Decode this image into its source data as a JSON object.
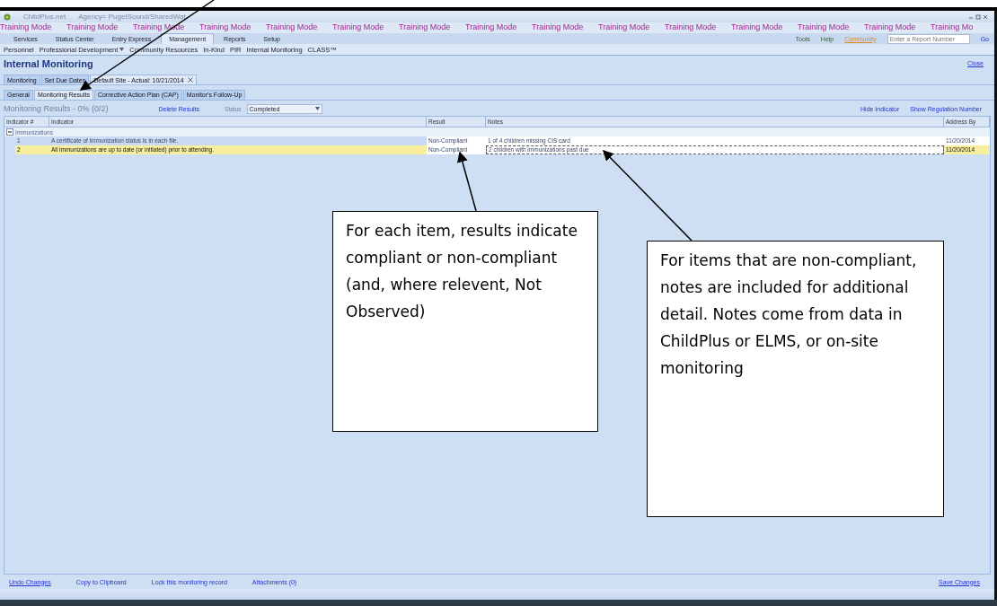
{
  "window": {
    "title": "ChildPlus.net",
    "agency": "Agency= PugetSound/SharedWat"
  },
  "training_banner": [
    "Training Mode",
    "Training Mode",
    "Training Mode",
    "Training Mode",
    "Training Mode",
    "Training Mode",
    "Training Mode",
    "Training Mode",
    "Training Mode",
    "Training Mode",
    "Training Mode",
    "Training Mode",
    "Training Mode",
    "Training Mode",
    "Training Mo"
  ],
  "main_tabs": [
    {
      "label": "Services",
      "selected": false
    },
    {
      "label": "Status Center",
      "selected": false
    },
    {
      "label": "Entry Express",
      "selected": false
    },
    {
      "label": "Management",
      "selected": true
    },
    {
      "label": "Reports",
      "selected": false
    },
    {
      "label": "Setup",
      "selected": false
    }
  ],
  "toolbar": {
    "tools": "Tools",
    "help": "Help",
    "community": "Community",
    "report_field": {
      "placeholder": "Enter a Report Number"
    },
    "go": "Go"
  },
  "submenu": [
    {
      "label": "Personnel",
      "dropdown": false
    },
    {
      "label": "Professional Development",
      "dropdown": true
    },
    {
      "label": "Community Resources",
      "dropdown": false
    },
    {
      "label": "In-Kind",
      "dropdown": false
    },
    {
      "label": "PIR",
      "dropdown": false
    },
    {
      "label": "Internal Monitoring",
      "dropdown": false
    },
    {
      "label": "CLASS™",
      "dropdown": false
    }
  ],
  "page": {
    "title": "Internal Monitoring",
    "close": "Close"
  },
  "doc_tabs": [
    {
      "label": "Monitoring",
      "selected": false,
      "closable": false
    },
    {
      "label": "Set Due Dates",
      "selected": false,
      "closable": false
    },
    {
      "label": "Default Site - Actual: 10/21/2014",
      "selected": true,
      "closable": true
    }
  ],
  "sub_tabs": [
    {
      "label": "General",
      "selected": false
    },
    {
      "label": "Monitoring Results",
      "selected": true
    },
    {
      "label": "Corrective Action Plan (CAP)",
      "selected": false
    },
    {
      "label": "Monitor's Follow-Up",
      "selected": false
    }
  ],
  "results_bar": {
    "heading": "Monitoring Results - 0% (0/2)",
    "delete": "Delete Results",
    "status_label": "Status",
    "status_value": "Completed",
    "hide_indicator": "Hide Indicator",
    "show_regulation": "Show Regulation Number"
  },
  "table": {
    "columns": [
      "Indicator #",
      "Indicator",
      "Result",
      "Notes",
      "Address By"
    ],
    "group": {
      "label": "Immunizations",
      "expanded": true
    },
    "rows": [
      {
        "number": "1",
        "indicator": "A certificate of immunization status is in each file.",
        "result": "Non-Compliant",
        "notes": "1 of 4 children missing CIS card",
        "address_by": "11/20/2014",
        "selected": false
      },
      {
        "number": "2",
        "indicator": "All immunizations are up to date (or initiated) prior to attending.",
        "result": "Non-Compliant",
        "notes": "2 children with immunizations past due",
        "address_by": "11/20/2014",
        "selected": true
      }
    ]
  },
  "footer": {
    "links": [
      "Undo Changes",
      "Copy to Clipboard",
      "Lock this monitoring record",
      "Attachments (0)"
    ],
    "save": "Save Changes"
  },
  "callouts": [
    {
      "text": "For each item, results indicate compliant or non-compliant (and, where relevent, Not Observed)"
    },
    {
      "text": "For items that are non-compliant, notes are included for additional detail. Notes come from data in ChildPlus or ELMS, or on-site monitoring"
    }
  ]
}
